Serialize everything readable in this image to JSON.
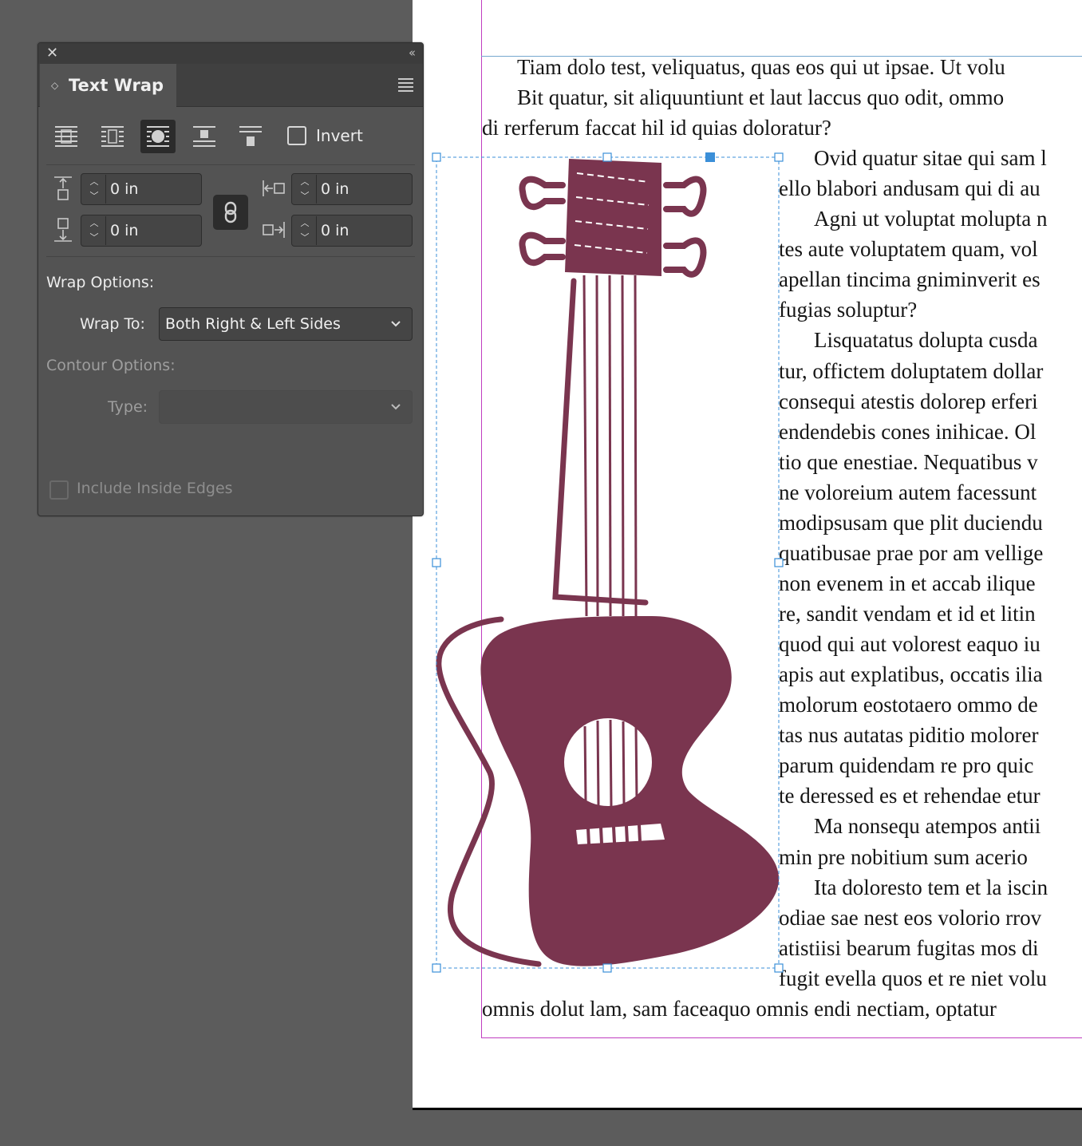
{
  "panel": {
    "title": "Text Wrap",
    "invert_label": "Invert",
    "wrap_modes": [
      "no-text-wrap",
      "wrap-around-bounding-box",
      "wrap-around-object-shape",
      "jump-object",
      "jump-to-next-column"
    ],
    "active_wrap_mode": "wrap-around-object-shape",
    "offsets": {
      "top": "0 in",
      "bottom": "0 in",
      "left": "0 in",
      "right": "0 in"
    },
    "wrap_options_label": "Wrap Options:",
    "wrap_to_label": "Wrap To:",
    "wrap_to_value": "Both Right & Left Sides",
    "contour_options_label": "Contour Options:",
    "type_label": "Type:",
    "type_value": "",
    "include_inside_edges_label": "Include Inside Edges"
  },
  "document": {
    "lines": [
      "Tiam dolo test, veliquatus, quas eos qui ut ipsae. Ut volu",
      "Bit quatur, sit aliquuntiunt et laut laccus quo odit, ommo",
      "di rerferum faccat hil id quias doloratur?",
      "Ovid quatur sitae qui sam l",
      "ello blabori andusam qui di au",
      "Agni ut voluptat molupta n",
      "tes aute voluptatem quam, vol",
      "apellan tincima gniminverit es",
      "fugias soluptur?",
      "Lisquatatus dolupta cusda",
      "tur, offictem doluptatem dollar",
      "consequi atestis dolorep erferi",
      "endendebis cones inihicae. Ol",
      "tio que enestiae. Nequatibus v",
      "ne voloreium autem facessunt",
      "modipsusam que plit duciendu",
      "quatibusae prae por am vellige",
      "non evenem in et accab ilique",
      "re, sandit vendam et id et litin",
      "quod qui aut volorest eaquo iu",
      "apis aut explatibus, occatis ilia",
      "molorum eostotaero ommo de",
      "tas nus autatas piditio molorer",
      "parum quidendam re pro quic",
      "te deressed es et rehendae etur",
      "Ma nonsequ atempos antii",
      "min pre nobitium sum acerio",
      "Ita doloresto tem et la iscin",
      "odiae sae nest eos volorio rrov",
      "atistiisi bearum fugitas mos di",
      "fugit evella quos et re niet volu",
      "omnis dolut lam, sam faceaquo omnis endi nectiam, optatur"
    ]
  },
  "colors": {
    "guitar": "#7a354f",
    "selection": "#3b8fd8",
    "margin": "#c03ec0"
  }
}
